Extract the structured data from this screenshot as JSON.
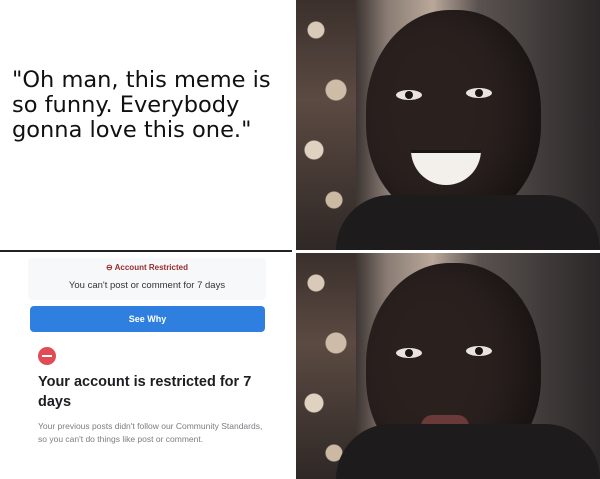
{
  "quote": "\"Oh man, this meme is so funny. Everybody gonna love this one.\"",
  "restriction_screenshot": {
    "banner_title": "⊖ Account Restricted",
    "banner_subtitle": "You can't post or comment for 7 days",
    "button_label": "See Why",
    "heading": "Your account is restricted for 7 days",
    "body": "Your previous posts didn't follow our Community Standards, so you can't do things like post or comment."
  },
  "colors": {
    "button_blue": "#2f7fe0",
    "restrict_red": "#e14b55"
  }
}
